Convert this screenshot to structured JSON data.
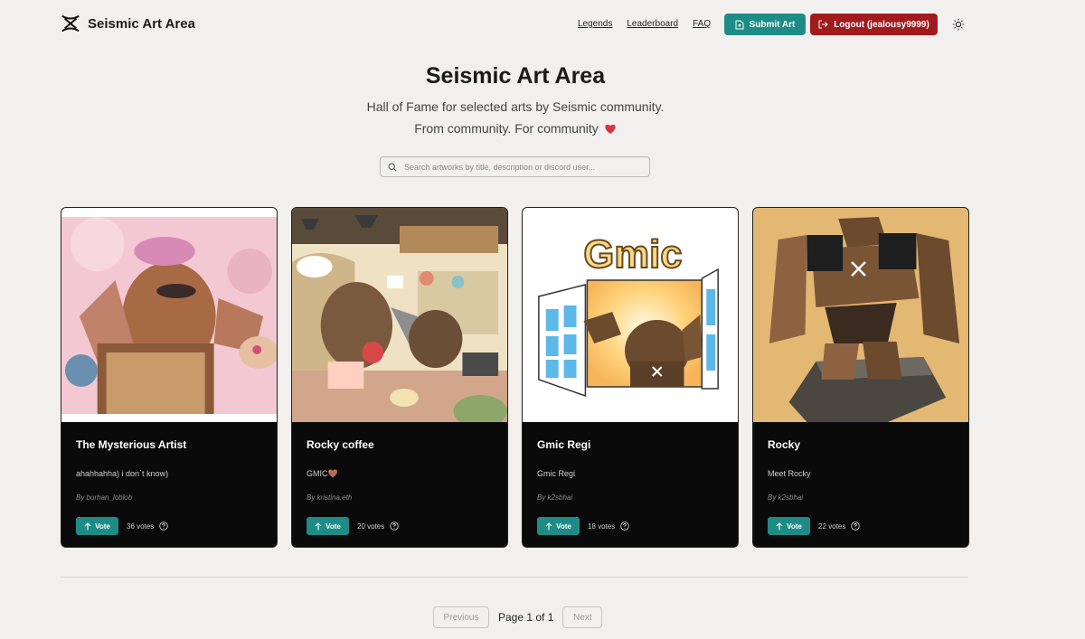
{
  "header": {
    "brand": "Seismic Art Area",
    "nav": [
      "Legends",
      "Leaderboard",
      "FAQ"
    ],
    "submit_label": "Submit Art",
    "logout_label": "Logout (jealousy9999)"
  },
  "hero": {
    "title": "Seismic Art Area",
    "subtitle": "Hall of Fame for selected arts by Seismic community.",
    "subtitle2": "From community. For community"
  },
  "search": {
    "placeholder": "Search artworks by title, description or discord user...",
    "value": ""
  },
  "cards": [
    {
      "title": "The Mysterious Artist",
      "description": "ahahhahha) i don`t know)",
      "author": "By burhan_loblob",
      "vote_label": "Vote",
      "votes": "36 votes"
    },
    {
      "title": "Rocky coffee",
      "description": "GMIC🤎",
      "author": "By kristina.eth",
      "vote_label": "Vote",
      "votes": "20 votes"
    },
    {
      "title": "Gmic Regi",
      "description": "Gmic Regi",
      "author": "By k2sbhai",
      "vote_label": "Vote",
      "votes": "18 votes"
    },
    {
      "title": "Rocky",
      "description": "Meet Rocky",
      "author": "By k2sbhai",
      "vote_label": "Vote",
      "votes": "22 votes"
    }
  ],
  "card_art_text": {
    "gmic": "Gmic"
  },
  "pagination": {
    "previous_label": "Previous",
    "page_info": "Page 1 of 1",
    "next_label": "Next"
  },
  "colors": {
    "accent": "#1e8c86",
    "danger": "#a11a1d",
    "card_bg": "#0a0a0a",
    "page_bg": "#f1f0ee"
  }
}
